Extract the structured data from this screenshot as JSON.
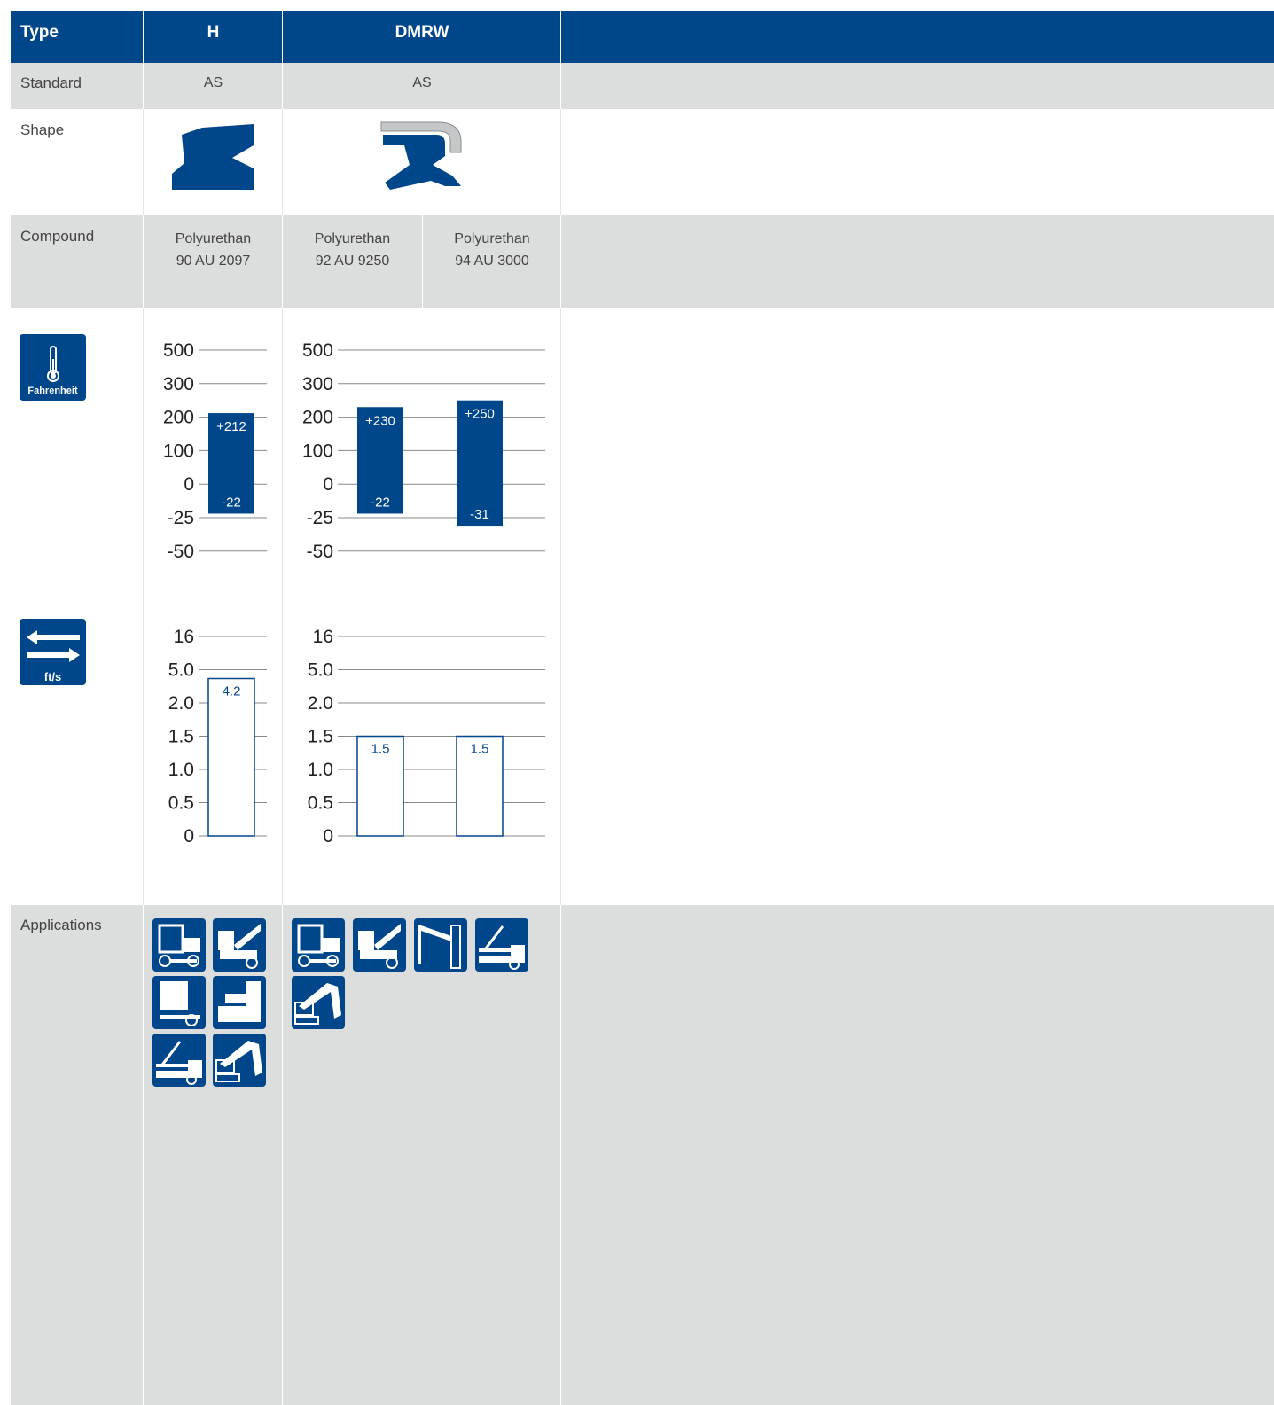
{
  "header": {
    "type_label": "Type",
    "col_h": "H",
    "col_dmrw": "DMRW"
  },
  "rows": {
    "standard": {
      "label": "Standard",
      "h": "AS",
      "dmrw": "AS"
    },
    "shape": {
      "label": "Shape"
    },
    "compound": {
      "label": "Compound",
      "items": [
        {
          "name": "Polyurethan",
          "code": "90 AU 2097"
        },
        {
          "name": "Polyurethan",
          "code": "92 AU 9250"
        },
        {
          "name": "Polyurethan",
          "code": "94 AU 3000"
        }
      ]
    },
    "applications": {
      "label": "Applications"
    }
  },
  "icons": {
    "temperature": {
      "icon": "thermometer-icon",
      "label": "Fahrenheit"
    },
    "speed": {
      "icon": "bidirectional-arrows-icon",
      "label": "ft/s"
    }
  },
  "chart_data": [
    {
      "type": "bar",
      "title": "",
      "scale_ticks": [
        "500",
        "300",
        "200",
        "100",
        "0",
        "-25",
        "-50"
      ],
      "series": [
        {
          "name": "90 AU 2097",
          "min": -22,
          "max": 212,
          "min_label": "-22",
          "max_label": "+212"
        }
      ]
    },
    {
      "type": "bar",
      "title": "",
      "scale_ticks": [
        "500",
        "300",
        "200",
        "100",
        "0",
        "-25",
        "-50"
      ],
      "series": [
        {
          "name": "92 AU 9250",
          "min": -22,
          "max": 230,
          "min_label": "-22",
          "max_label": "+230"
        },
        {
          "name": "94 AU 3000",
          "min": -31,
          "max": 250,
          "min_label": "-31",
          "max_label": "+250"
        }
      ]
    },
    {
      "type": "bar",
      "title": "",
      "scale_ticks": [
        "16",
        "5.0",
        "2.0",
        "1.5",
        "1.0",
        "0.5",
        "0"
      ],
      "series": [
        {
          "name": "90 AU 2097",
          "value": 4.2,
          "label": "4.2"
        }
      ]
    },
    {
      "type": "bar",
      "title": "",
      "scale_ticks": [
        "16",
        "5.0",
        "2.0",
        "1.5",
        "1.0",
        "0.5",
        "0"
      ],
      "series": [
        {
          "name": "92 AU 9250",
          "value": 1.5,
          "label": "1.5"
        },
        {
          "name": "94 AU 3000",
          "value": 1.5,
          "label": "1.5"
        }
      ]
    }
  ],
  "applications": {
    "h": [
      "tractor-icon",
      "crane-truck-icon",
      "press-icon",
      "injection-machine-icon",
      "loading-crane-icon",
      "excavator-icon"
    ],
    "dmrw": [
      "tractor-icon",
      "crane-truck-icon",
      "barrier-icon",
      "loading-crane-icon",
      "excavator-icon"
    ]
  },
  "colors": {
    "brand": "#00468b",
    "band": "#dcdddd"
  }
}
